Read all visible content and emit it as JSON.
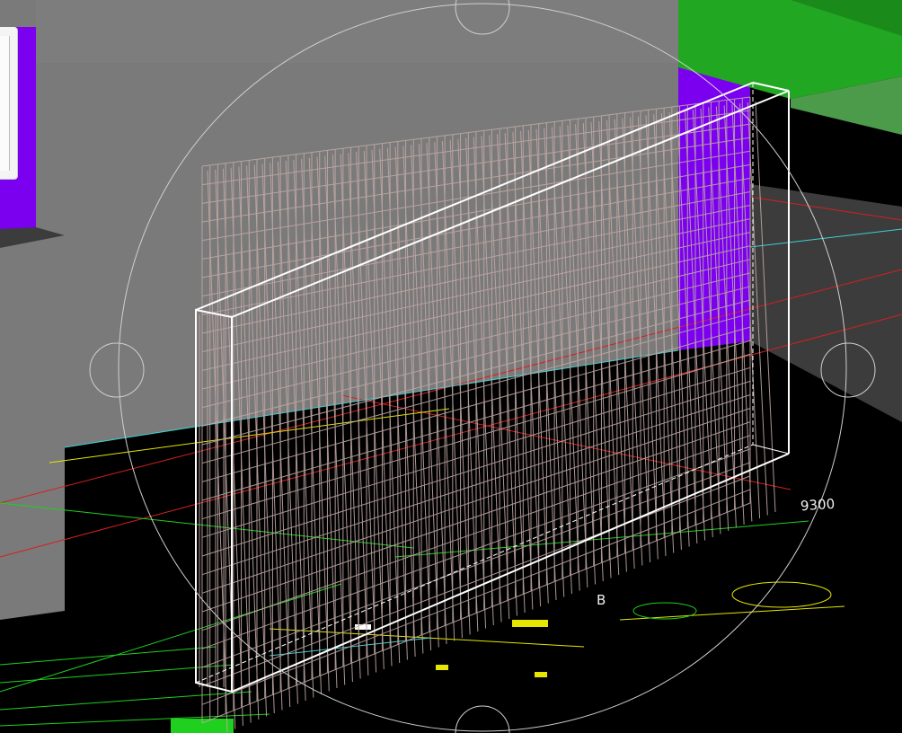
{
  "viewport": {
    "dimension_text": "9300",
    "point_label": "B"
  },
  "colors": {
    "background": "#000000",
    "gray_wall": "#7a7a7a",
    "dark_floor": "#3a3a3a",
    "purple": "#7b00f0",
    "green": "#22a722",
    "wire": "#bfa8a3",
    "bbox": "#ffffff",
    "cad_yellow": "#ffff00",
    "cad_red": "#d42020",
    "cad_green": "#1fd01f",
    "cad_cyan": "#3fd0d0"
  },
  "icons": {
    "gizmo": "orbit-gizmo-icon",
    "handle": "orbit-handle-icon"
  }
}
